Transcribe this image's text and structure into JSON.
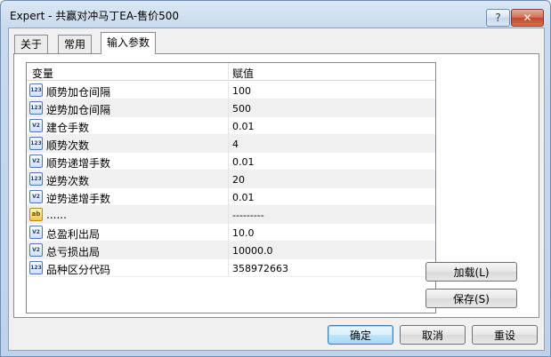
{
  "window": {
    "title": "Expert - 共赢对冲马丁EA-售价500",
    "help_label": "?",
    "close_label": "✕"
  },
  "tabs": [
    {
      "label": "关于",
      "active": false
    },
    {
      "label": "常用",
      "active": false
    },
    {
      "label": "输入参数",
      "active": true
    }
  ],
  "grid": {
    "headers": {
      "variable": "变量",
      "value": "赋值"
    },
    "rows": [
      {
        "icon": "123",
        "name": "顺势加仓间隔",
        "value": "100"
      },
      {
        "icon": "123",
        "name": "逆势加仓间隔",
        "value": "500"
      },
      {
        "icon": "V2",
        "name": "建仓手数",
        "value": "0.01"
      },
      {
        "icon": "123",
        "name": "顺势次数",
        "value": "4"
      },
      {
        "icon": "V2",
        "name": "顺势递增手数",
        "value": "0.01"
      },
      {
        "icon": "123",
        "name": "逆势次数",
        "value": "20"
      },
      {
        "icon": "V2",
        "name": "逆势递增手数",
        "value": "0.01"
      },
      {
        "icon": "ab",
        "name": "......",
        "value": "---------"
      },
      {
        "icon": "V2",
        "name": "总盈利出局",
        "value": "10.0"
      },
      {
        "icon": "V2",
        "name": "总亏损出局",
        "value": "10000.0"
      },
      {
        "icon": "123",
        "name": "品种区分代码",
        "value": "358972663"
      }
    ]
  },
  "buttons": {
    "load": "加载(L)",
    "save": "保存(S)",
    "ok": "确定",
    "cancel": "取消",
    "reset": "重设"
  }
}
